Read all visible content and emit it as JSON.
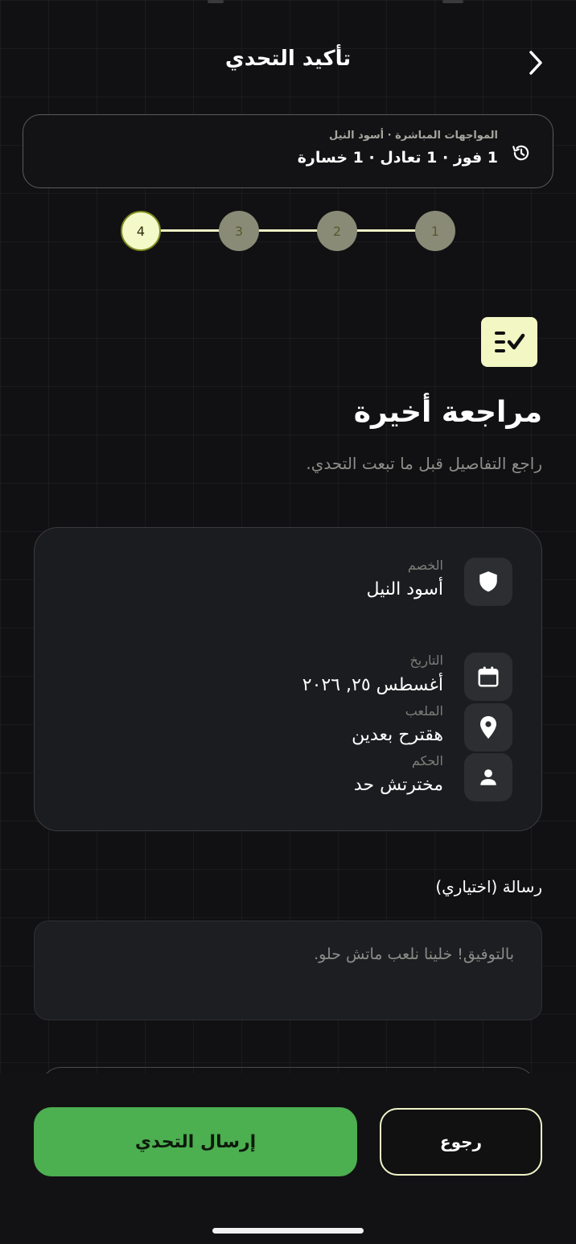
{
  "header": {
    "title": "تأكيد التحدي"
  },
  "head_to_head": {
    "label": "المواجهات المباشرة · أسود النيل",
    "record": "1 فوز · 1 تعادل · 1 خسارة"
  },
  "stepper": {
    "steps": [
      "1",
      "2",
      "3",
      "4"
    ],
    "current": 4
  },
  "review": {
    "title": "مراجعة أخيرة",
    "subtitle": "راجع التفاصيل قبل ما تبعت التحدي."
  },
  "details": {
    "opponent": {
      "label": "الخصم",
      "value": "أسود النيل"
    },
    "date": {
      "label": "التاريخ",
      "value": "أغسطس ٢٥, ٢٠٢٦"
    },
    "venue": {
      "label": "الملعب",
      "value": "هقترح بعدين"
    },
    "referee": {
      "label": "الحكم",
      "value": "مخترتش حد"
    }
  },
  "message": {
    "label": "رسالة (اختياري)",
    "placeholder": "بالتوفيق! خلينا نلعب ماتش حلو."
  },
  "actions": {
    "send": "إرسال التحدي",
    "back": "رجوع"
  },
  "colors": {
    "accent_lime": "#f2f7c4",
    "primary_green": "#4caf50",
    "background": "#111113",
    "card": "#1b1c1f"
  },
  "icons": {
    "back": "chevron-right-icon",
    "history": "history-icon",
    "review": "checklist-icon",
    "opponent": "shield-icon",
    "date": "calendar-icon",
    "venue": "location-pin-icon",
    "referee": "person-icon"
  }
}
